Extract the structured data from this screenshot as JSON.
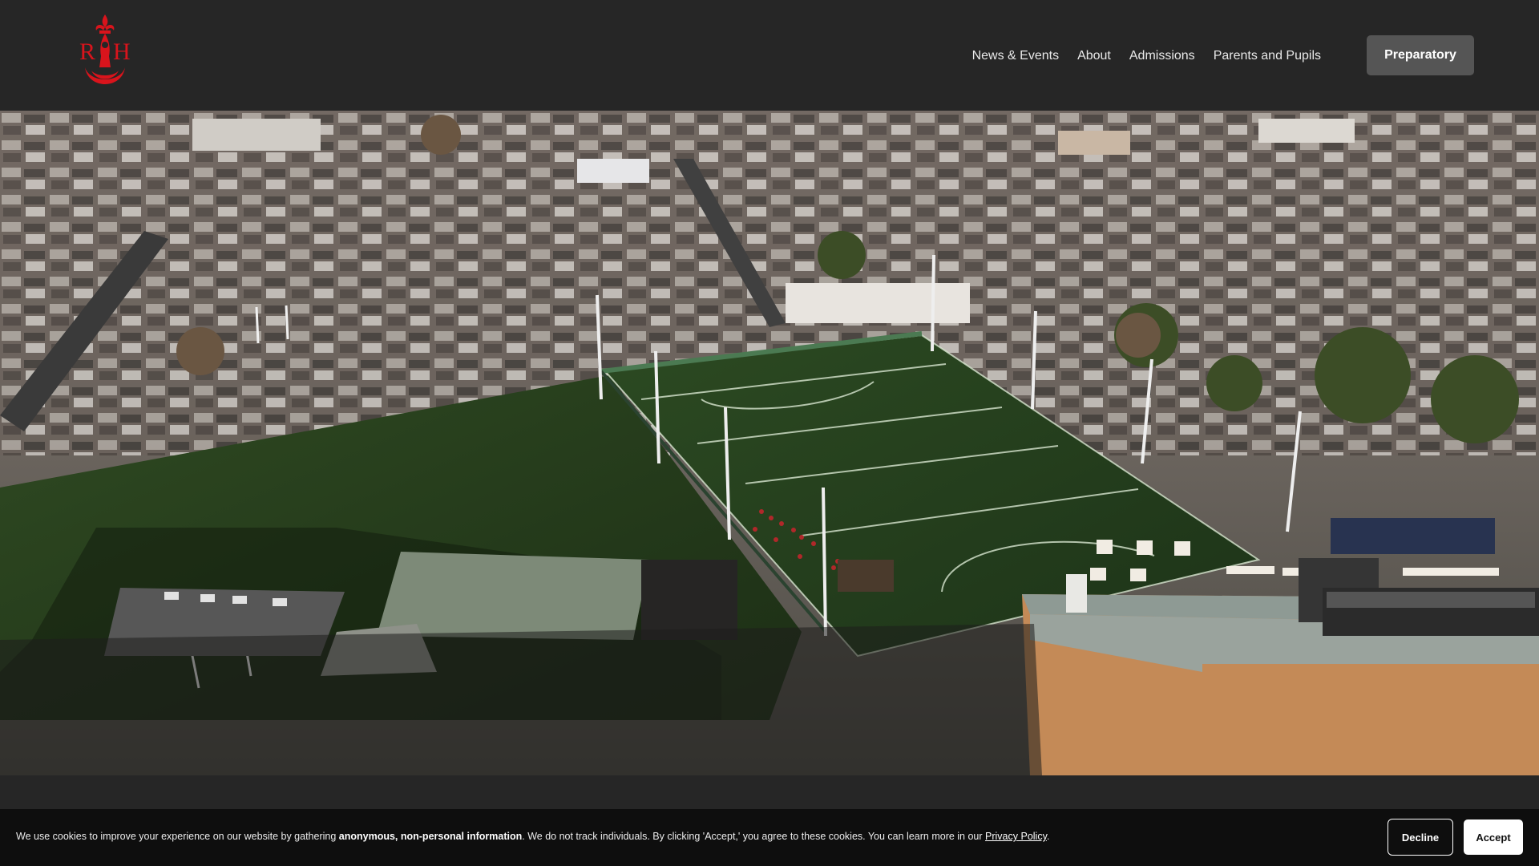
{
  "logo": {
    "letters": "RH"
  },
  "nav": {
    "items": [
      {
        "label": "News & Events"
      },
      {
        "label": "About"
      },
      {
        "label": "Admissions"
      },
      {
        "label": "Parents and Pupils"
      }
    ],
    "cta_label": "Preparatory"
  },
  "cookie": {
    "text_pre": "We use cookies to improve your experience on our website by gathering ",
    "text_bold": "anonymous, non-personal information",
    "text_mid": ". We do not track individuals. By clicking 'Accept,' you agree to these cookies. You can learn more in our ",
    "link_label": "Privacy Policy",
    "text_post": ".",
    "decline_label": "Decline",
    "accept_label": "Accept"
  },
  "colors": {
    "header_bg": "#262626",
    "brand_red": "#d9141c",
    "cta_bg": "#555555",
    "cookie_bg": "#0e0e0e"
  }
}
